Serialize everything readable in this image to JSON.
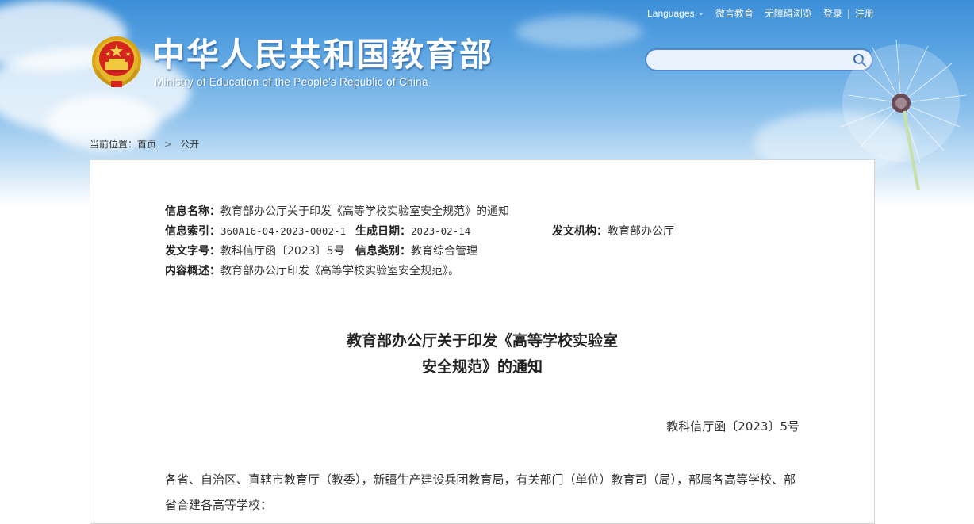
{
  "header": {
    "languages_label": "Languages",
    "links": [
      "微言教育",
      "无障碍浏览",
      "登录",
      "注册"
    ],
    "brand_cn": "中华人民共和国教育部",
    "brand_en": "Ministry of Education of the People's Republic of China",
    "search_placeholder": ""
  },
  "breadcrumb": {
    "prefix": "当前位置：",
    "items": [
      "首页",
      "公开"
    ]
  },
  "info": {
    "name_key": "信息名称：",
    "name_val": "教育部办公厅关于印发《高等学校实验室安全规范》的通知",
    "index_key": "信息索引：",
    "index_val": "360A16-04-2023-0002-1",
    "date_key": "生成日期：",
    "date_val": "2023-02-14",
    "org_key": "发文机构：",
    "org_val": "教育部办公厅",
    "docno_key": "发文字号：",
    "docno_val": "教科信厅函〔2023〕5号",
    "category_key": "信息类别：",
    "category_val": "教育综合管理",
    "summary_key": "内容概述：",
    "summary_val": "教育部办公厅印发《高等学校实验室安全规范》。"
  },
  "article": {
    "title_line1": "教育部办公厅关于印发《高等学校实验室",
    "title_line2": "安全规范》的通知",
    "doc_number": "教科信厅函〔2023〕5号",
    "body": "各省、自治区、直辖市教育厅（教委），新疆生产建设兵团教育局，有关部门（单位）教育司（局），部属各高等学校、部省合建各高等学校："
  }
}
